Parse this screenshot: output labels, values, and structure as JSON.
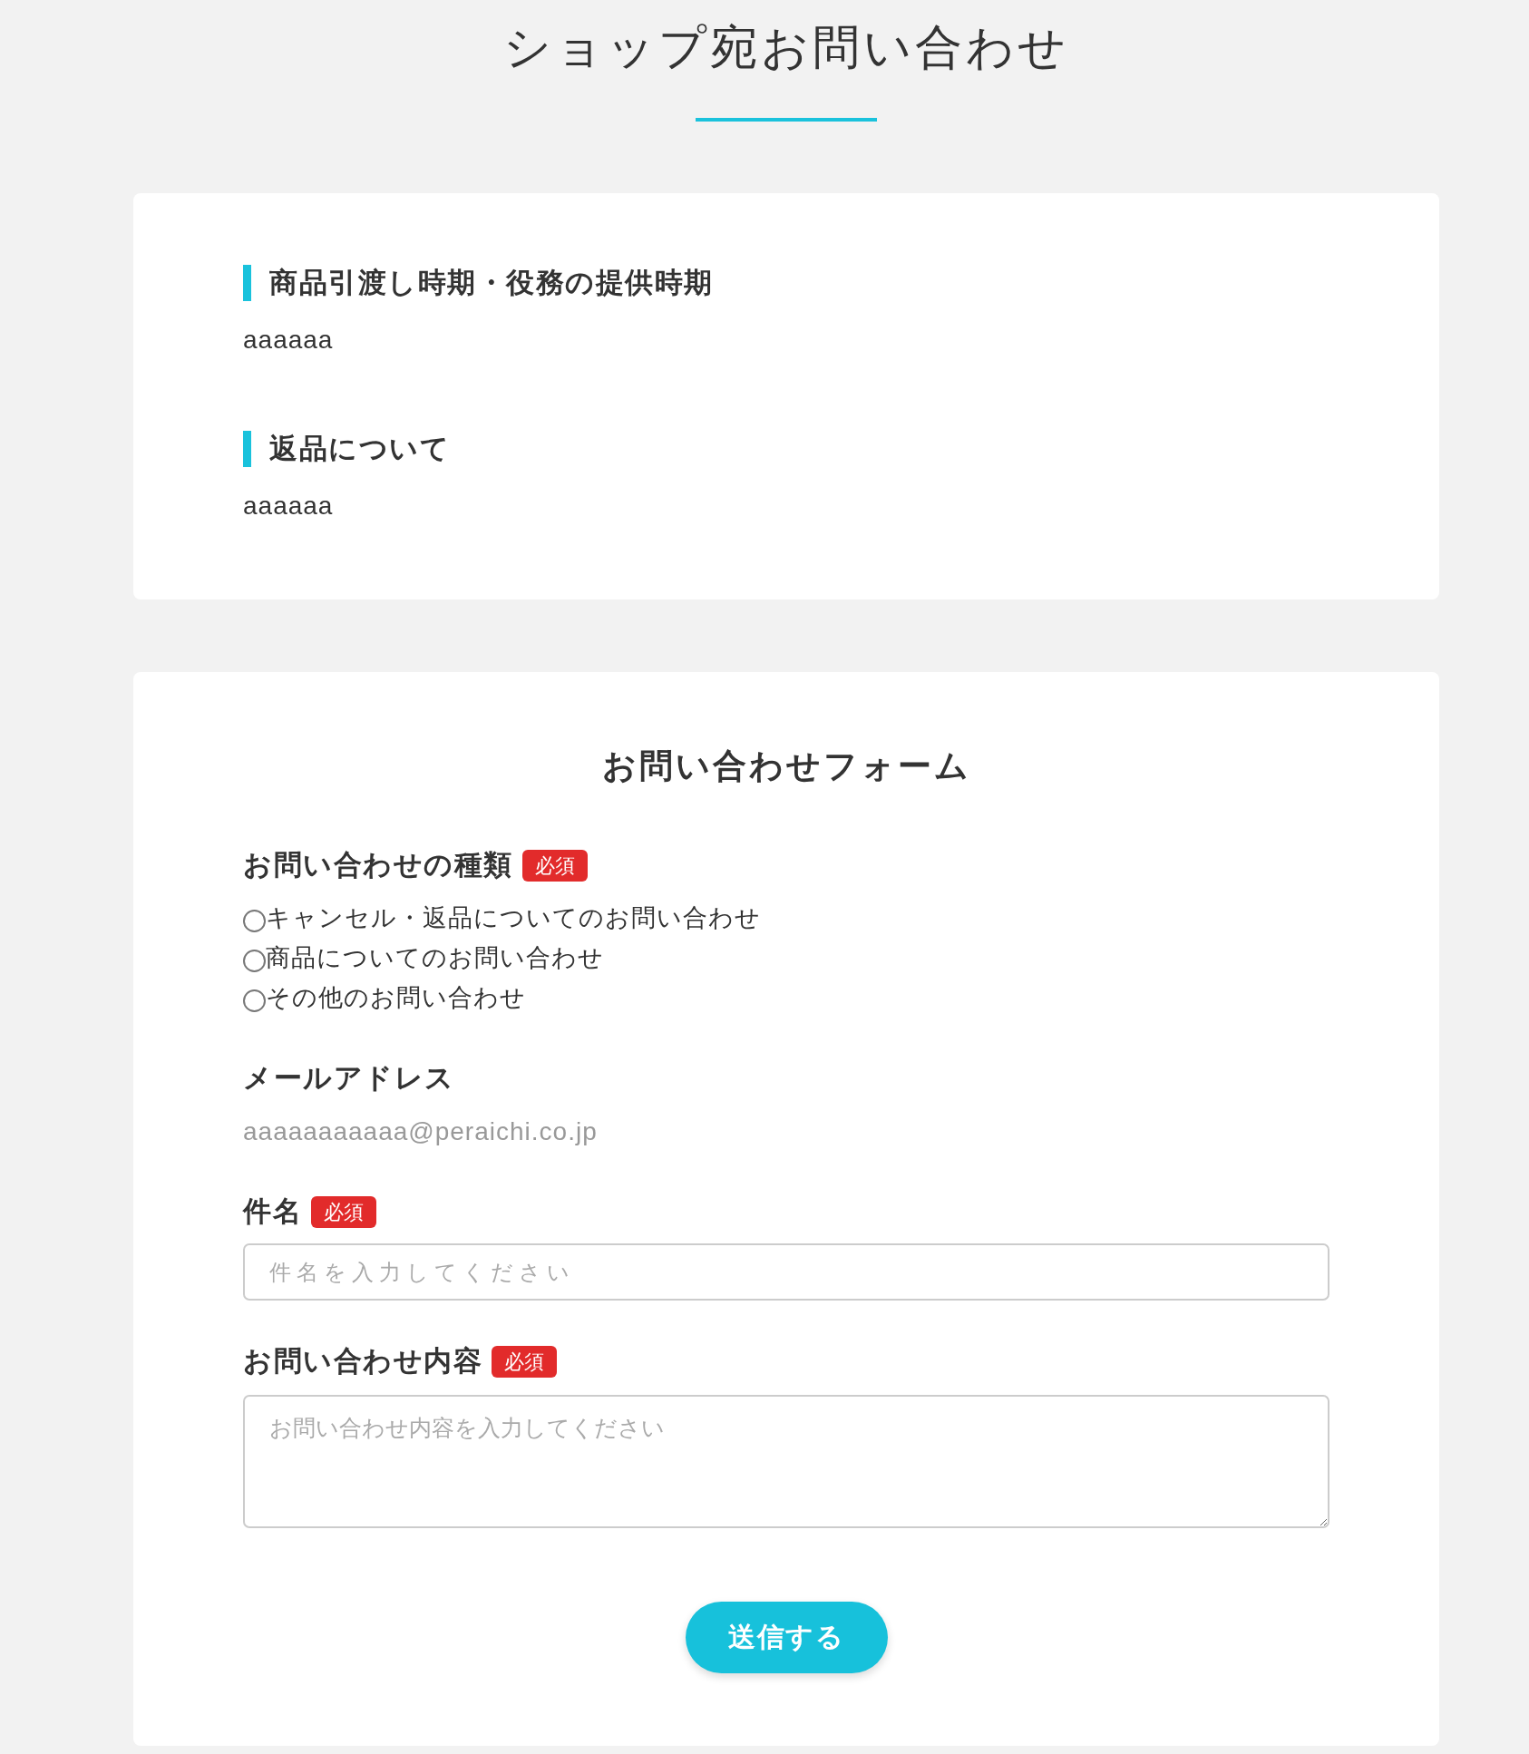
{
  "page_title": "ショップ宛お問い合わせ",
  "info_sections": [
    {
      "heading": "商品引渡し時期・役務の提供時期",
      "body": "aaaaaa"
    },
    {
      "heading": "返品について",
      "body": "aaaaaa"
    }
  ],
  "form": {
    "title": "お問い合わせフォーム",
    "fields": [
      {
        "kind": "radio",
        "label": "お問い合わせの種類",
        "required_badge": "必須",
        "options": [
          {
            "label": "キャンセル・返品についてのお問い合わせ",
            "selected": false
          },
          {
            "label": "商品についてのお問い合わせ",
            "selected": false
          },
          {
            "label": "その他のお問い合わせ",
            "selected": false
          }
        ]
      },
      {
        "kind": "static",
        "label": "メールアドレス",
        "value": "aaaaaaaaaaa@peraichi.co.jp"
      },
      {
        "kind": "text",
        "label": "件名",
        "required_badge": "必須",
        "placeholder": "件名を入力してください"
      },
      {
        "kind": "textarea",
        "label": "お問い合わせ内容",
        "required_badge": "必須",
        "placeholder": "お問い合わせ内容を入力してください"
      }
    ],
    "submit_button": "送信する"
  }
}
